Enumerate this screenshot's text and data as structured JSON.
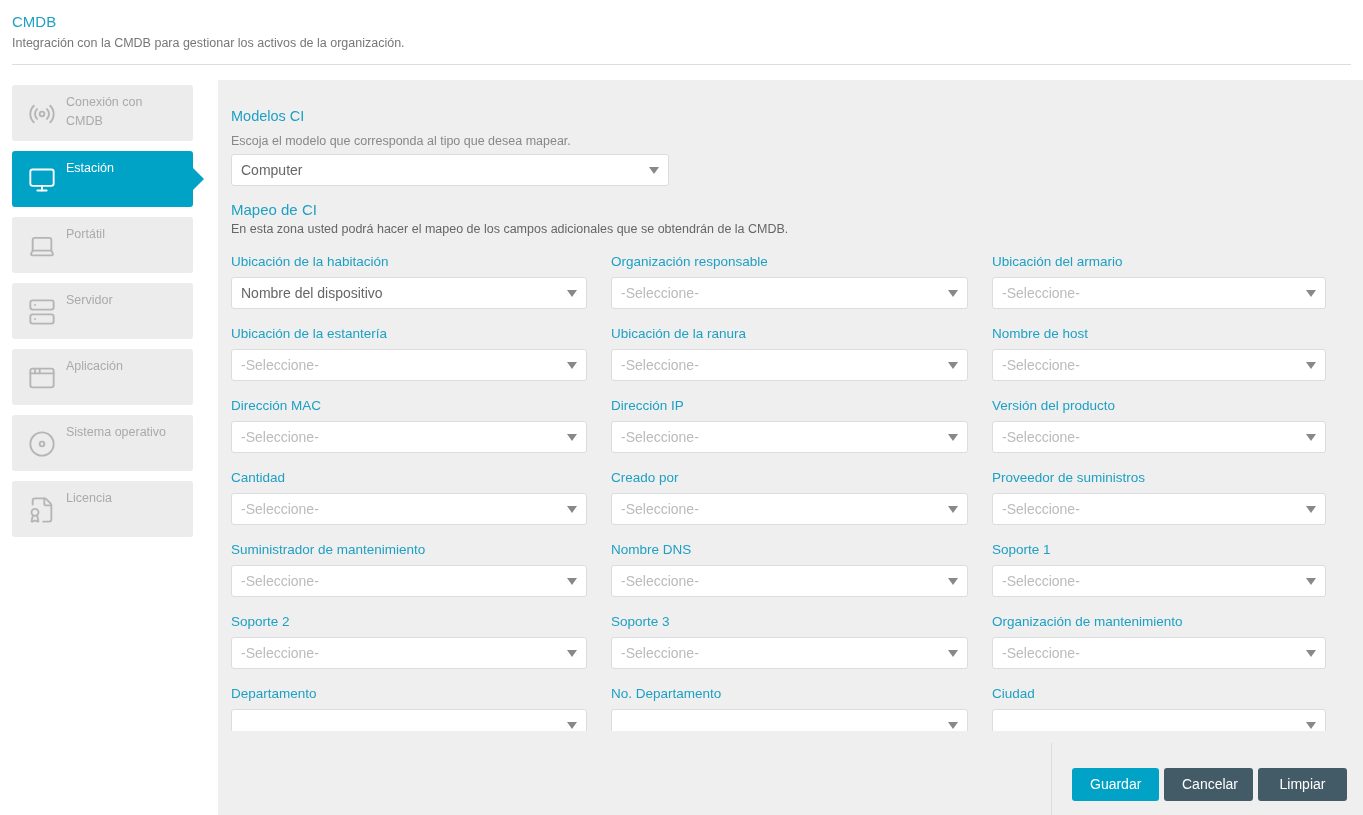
{
  "header": {
    "title": "CMDB",
    "description": "Integración con la CMDB para gestionar los activos de la organización."
  },
  "sidebar": {
    "items": [
      {
        "label": "Conexión con CMDB",
        "selected": false
      },
      {
        "label": "Estación",
        "selected": true
      },
      {
        "label": "Portátil",
        "selected": false
      },
      {
        "label": "Servidor",
        "selected": false
      },
      {
        "label": "Aplicación",
        "selected": false
      },
      {
        "label": "Sistema operativo",
        "selected": false
      },
      {
        "label": "Licencia",
        "selected": false
      }
    ]
  },
  "models": {
    "title": "Modelos CI",
    "hint": "Escoja el modelo que corresponda al tipo que desea mapear.",
    "value": "Computer"
  },
  "mapping": {
    "title": "Mapeo de CI",
    "hint": "En esta zona usted podrá hacer el mapeo de los campos adicionales que se obtendrán de la CMDB.",
    "fields": [
      {
        "label": "Ubicación de la habitación",
        "value": "Nombre del dispositivo"
      },
      {
        "label": "Organización responsable",
        "placeholder": "-Seleccione-"
      },
      {
        "label": "Ubicación del armario",
        "placeholder": "-Seleccione-"
      },
      {
        "label": "Ubicación de la estantería",
        "placeholder": "-Seleccione-"
      },
      {
        "label": "Ubicación de la ranura",
        "placeholder": "-Seleccione-"
      },
      {
        "label": "Nombre de host",
        "placeholder": "-Seleccione-"
      },
      {
        "label": "Dirección MAC",
        "placeholder": "-Seleccione-"
      },
      {
        "label": "Dirección IP",
        "placeholder": "-Seleccione-"
      },
      {
        "label": "Versión del producto",
        "placeholder": "-Seleccione-"
      },
      {
        "label": "Cantidad",
        "placeholder": "-Seleccione-"
      },
      {
        "label": "Creado por",
        "placeholder": "-Seleccione-"
      },
      {
        "label": "Proveedor de suministros",
        "placeholder": "-Seleccione-"
      },
      {
        "label": "Suministrador de mantenimiento",
        "placeholder": "-Seleccione-"
      },
      {
        "label": "Nombre DNS",
        "placeholder": "-Seleccione-"
      },
      {
        "label": "Soporte 1",
        "placeholder": "-Seleccione-"
      },
      {
        "label": "Soporte 2",
        "placeholder": "-Seleccione-"
      },
      {
        "label": "Soporte 3",
        "placeholder": "-Seleccione-"
      },
      {
        "label": "Organización de mantenimiento",
        "placeholder": "-Seleccione-"
      },
      {
        "label": "Departamento"
      },
      {
        "label": "No. Departamento"
      },
      {
        "label": "Ciudad"
      }
    ]
  },
  "buttons": [
    {
      "label": "Guardar",
      "kind": "primary"
    },
    {
      "label": "Cancelar",
      "kind": "secondary"
    },
    {
      "label": "Limpiar",
      "kind": "secondary"
    }
  ]
}
